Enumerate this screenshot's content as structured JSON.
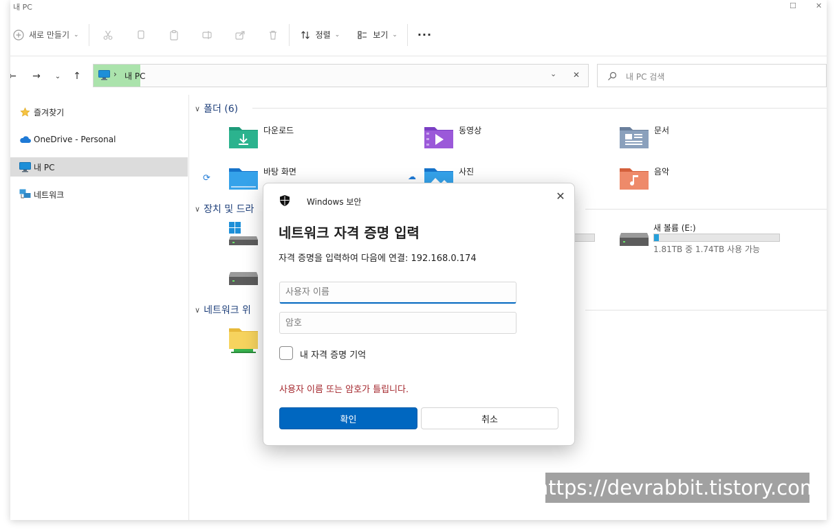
{
  "window": {
    "title": "내 PC"
  },
  "toolbar": {
    "new_label": "새로 만들기",
    "sort_label": "정렬",
    "view_label": "보기",
    "more_label": "···"
  },
  "address": {
    "path": "내 PC",
    "search_placeholder": "내 PC 검색"
  },
  "sidebar": {
    "items": [
      {
        "label": "즐겨찾기",
        "icon": "star-icon"
      },
      {
        "label": "OneDrive - Personal",
        "icon": "cloud-icon"
      },
      {
        "label": "내 PC",
        "icon": "monitor-icon",
        "selected": true
      },
      {
        "label": "네트워크",
        "icon": "network-icon"
      }
    ]
  },
  "groups": {
    "folders_header": "폴더 (6)",
    "devices_header": "장치 및 드라",
    "network_header": "네트워크 위"
  },
  "folders": [
    {
      "label": "다운로드",
      "icon": "downloads-folder-icon"
    },
    {
      "label": "동영상",
      "icon": "videos-folder-icon"
    },
    {
      "label": "문서",
      "icon": "documents-folder-icon"
    },
    {
      "label": "바탕 화면",
      "icon": "desktop-folder-icon"
    },
    {
      "label": "사진",
      "icon": "pictures-folder-icon"
    },
    {
      "label": "음악",
      "icon": "music-folder-icon"
    }
  ],
  "drives": [
    {
      "label": "새 볼륨 (E:)",
      "info": "1.81TB 중 1.74TB 사용 가능",
      "used_fraction": 0.04
    }
  ],
  "dialog": {
    "brand": "Windows 보안",
    "title": "네트워크 자격 증명 입력",
    "description": "자격 증명을 입력하여 다음에 연결: 192.168.0.174",
    "username_placeholder": "사용자 이름",
    "password_placeholder": "암호",
    "remember_label": "내 자격 증명 기억",
    "error": "사용자 이름 또는 암호가 틀립니다.",
    "ok_label": "확인",
    "cancel_label": "취소"
  },
  "watermark": "https://devrabbit.tistory.com",
  "colors": {
    "accent": "#0067c0",
    "error": "#a4262c",
    "address_highlight": "#abe3ac"
  }
}
